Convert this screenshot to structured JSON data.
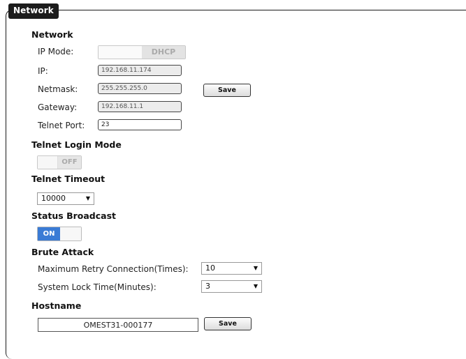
{
  "section": {
    "title": "Network"
  },
  "network": {
    "heading": "Network",
    "ip_mode": {
      "label": "IP Mode:",
      "value": "DHCP"
    },
    "ip": {
      "label": "IP:",
      "value": "192.168.11.174"
    },
    "netmask": {
      "label": "Netmask:",
      "value": "255.255.255.0"
    },
    "gateway": {
      "label": "Gateway:",
      "value": "192.168.11.1"
    },
    "telnet_port": {
      "label": "Telnet Port:",
      "value": "23"
    },
    "save_label": "Save"
  },
  "telnet_login": {
    "heading": "Telnet Login Mode",
    "state": "OFF"
  },
  "telnet_timeout": {
    "heading": "Telnet Timeout",
    "value": "10000"
  },
  "status_broadcast": {
    "heading": "Status Broadcast",
    "state": "ON",
    "accent": "#3a7bd5"
  },
  "brute_attack": {
    "heading": "Brute Attack",
    "max_retry": {
      "label": "Maximum Retry Connection(Times):",
      "value": "10"
    },
    "lock_time": {
      "label": "System Lock Time(Minutes):",
      "value": "3"
    }
  },
  "hostname": {
    "heading": "Hostname",
    "value": "OMEST31-000177",
    "save_label": "Save"
  }
}
